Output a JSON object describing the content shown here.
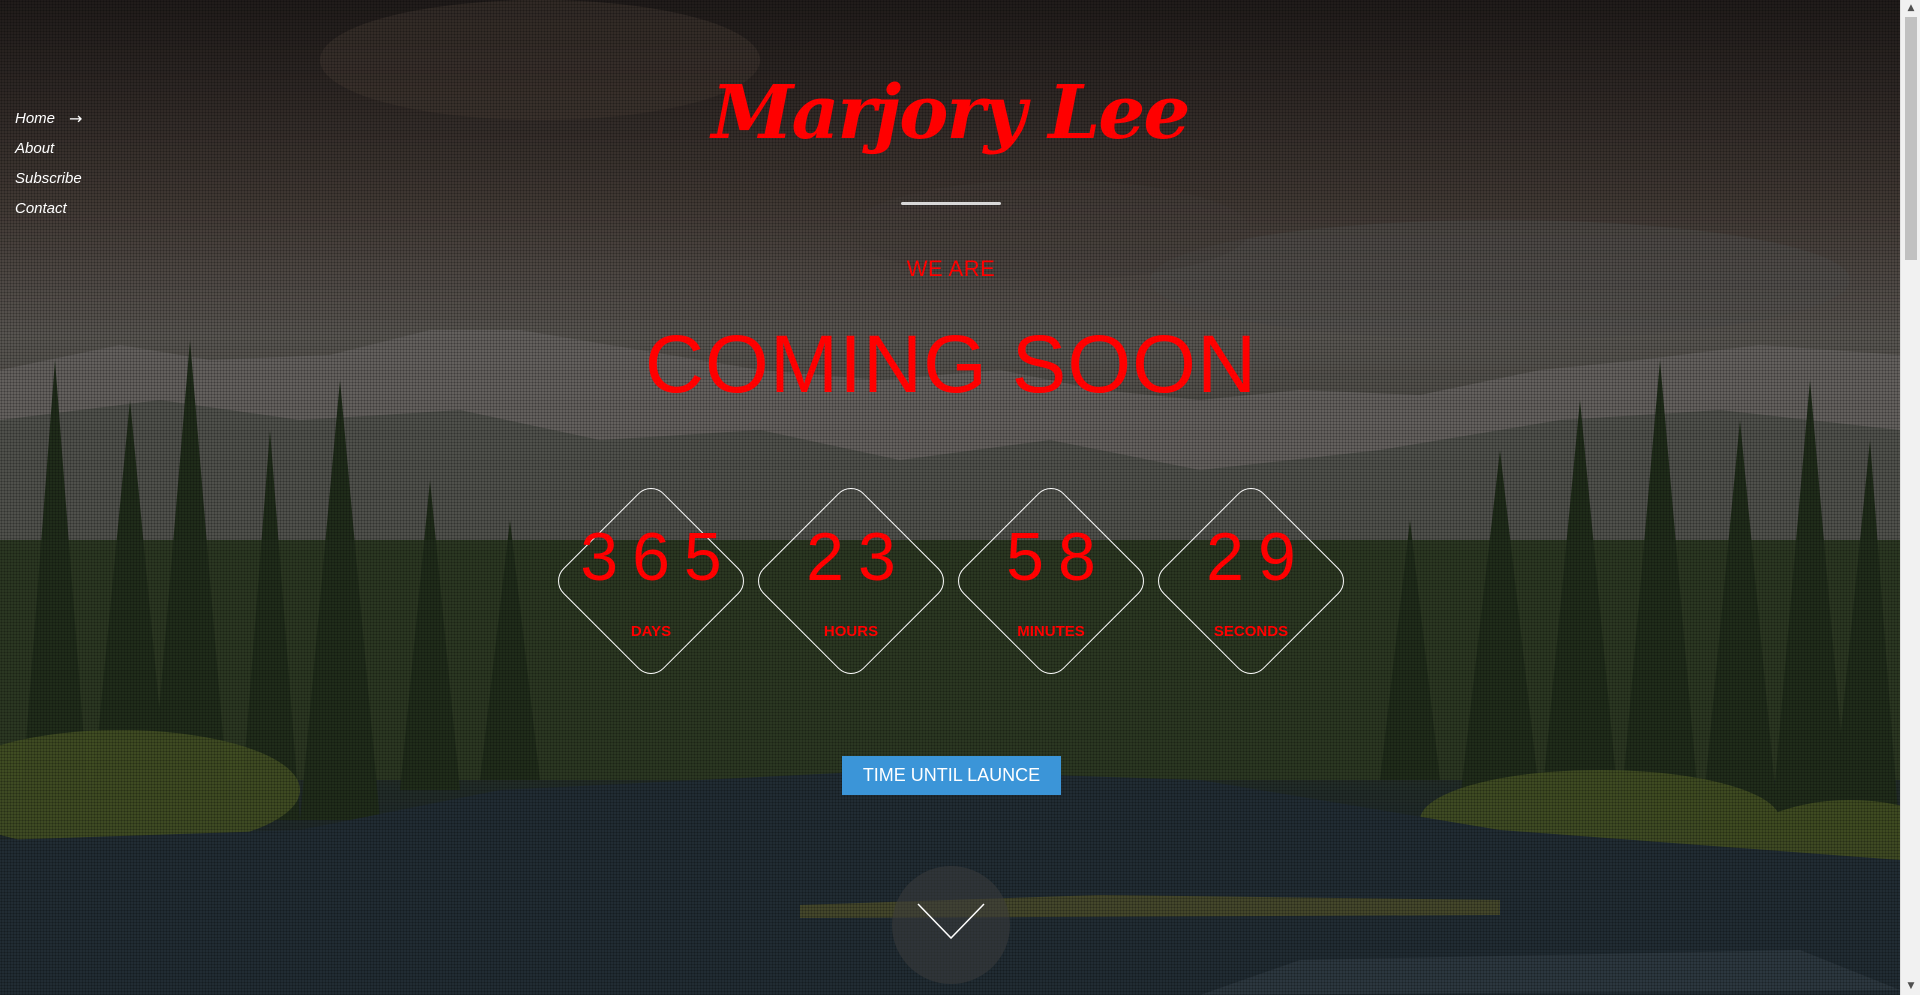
{
  "nav": {
    "items": [
      {
        "label": "Home",
        "active": true,
        "arrow": "→"
      },
      {
        "label": "About"
      },
      {
        "label": "Subscribe"
      },
      {
        "label": "Contact"
      }
    ]
  },
  "brand": {
    "name": "Marjory Lee"
  },
  "hero": {
    "tagline": "WE ARE",
    "headline": "COMING SOON"
  },
  "countdown": [
    {
      "value": "365",
      "label": "DAYS"
    },
    {
      "value": "23",
      "label": "HOURS"
    },
    {
      "value": "58",
      "label": "MINUTES"
    },
    {
      "value": "29",
      "label": "SECONDS"
    }
  ],
  "cta": {
    "label": "TIME UNTIL LAUNCE"
  },
  "icons": {
    "nav_arrow": "arrow-right-icon",
    "scroll_down": "chevron-down-icon"
  },
  "colors": {
    "accent_text": "#ff0000",
    "button": "#3b95d8",
    "nav_text": "#ffffff"
  }
}
